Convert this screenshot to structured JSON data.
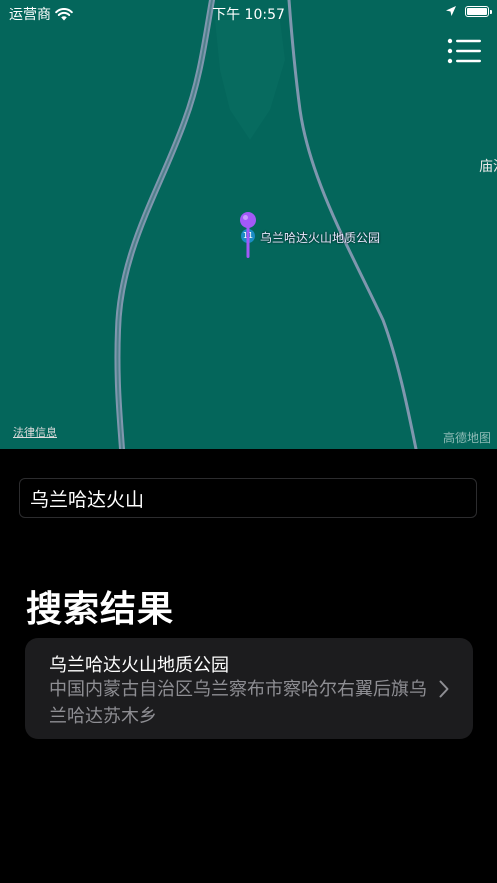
{
  "status_bar": {
    "carrier": "运营商",
    "time": "下午 10:57",
    "icons": [
      "wifi-icon",
      "location-arrow-icon",
      "battery-icon"
    ]
  },
  "map": {
    "poi_name": "乌兰哈达火山地质公园",
    "poi_badge": "11",
    "edge_label": "庙沟",
    "legal_link": "法律信息",
    "logo_text": "高德地图",
    "colors": {
      "land": "#04665b",
      "road": "#7f97ae",
      "pin": "#a259f7"
    }
  },
  "toolbar": {
    "menu_icon": "list-menu-icon"
  },
  "search": {
    "value": "乌兰哈达火山",
    "placeholder": ""
  },
  "results": {
    "title": "搜索结果",
    "items": [
      {
        "name": "乌兰哈达火山地质公园",
        "address": "中国内蒙古自治区乌兰察布市察哈尔右翼后旗乌兰哈达苏木乡"
      }
    ]
  }
}
